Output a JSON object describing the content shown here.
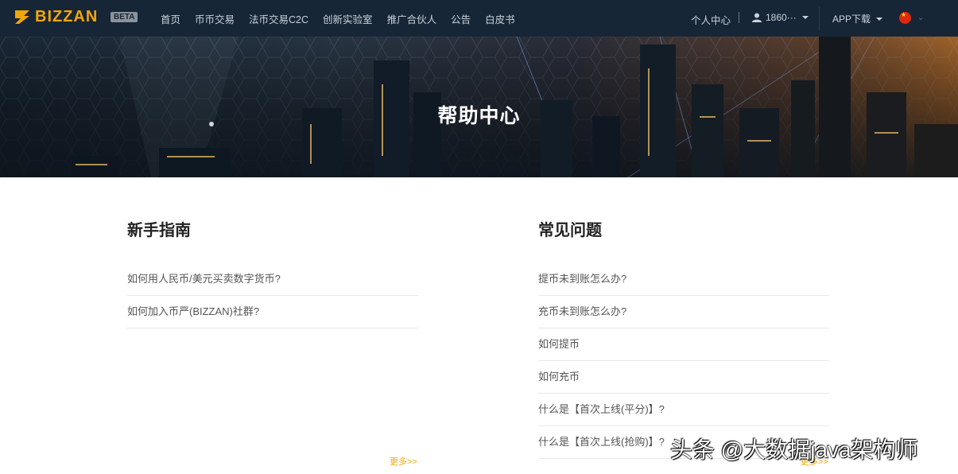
{
  "nav": {
    "logo_text": "BIZZAN",
    "beta": "BETA",
    "menu": [
      "首页",
      "币币交易",
      "法币交易C2C",
      "创新实验室",
      "推广合伙人",
      "公告",
      "白皮书"
    ],
    "personal_center": "个人中心",
    "user_phone": "1860···",
    "app_download": "APP下载"
  },
  "banner": {
    "title": "帮助中心"
  },
  "left": {
    "title": "新手指南",
    "items": [
      "如何用人民币/美元买卖数字货币?",
      "如何加入币严(BIZZAN)社群?"
    ],
    "more": "更多>>"
  },
  "right": {
    "title": "常见问题",
    "items": [
      "提币未到账怎么办?",
      "充币未到账怎么办?",
      "如何提币",
      "如何充币",
      "什么是【首次上线(平分)】?",
      "什么是【首次上线(抢购)】?"
    ],
    "more": "更多>>"
  },
  "watermark": "头条 @大数据java架构师",
  "colors": {
    "nav_bg": "#172636",
    "accent": "#f0a70a"
  }
}
